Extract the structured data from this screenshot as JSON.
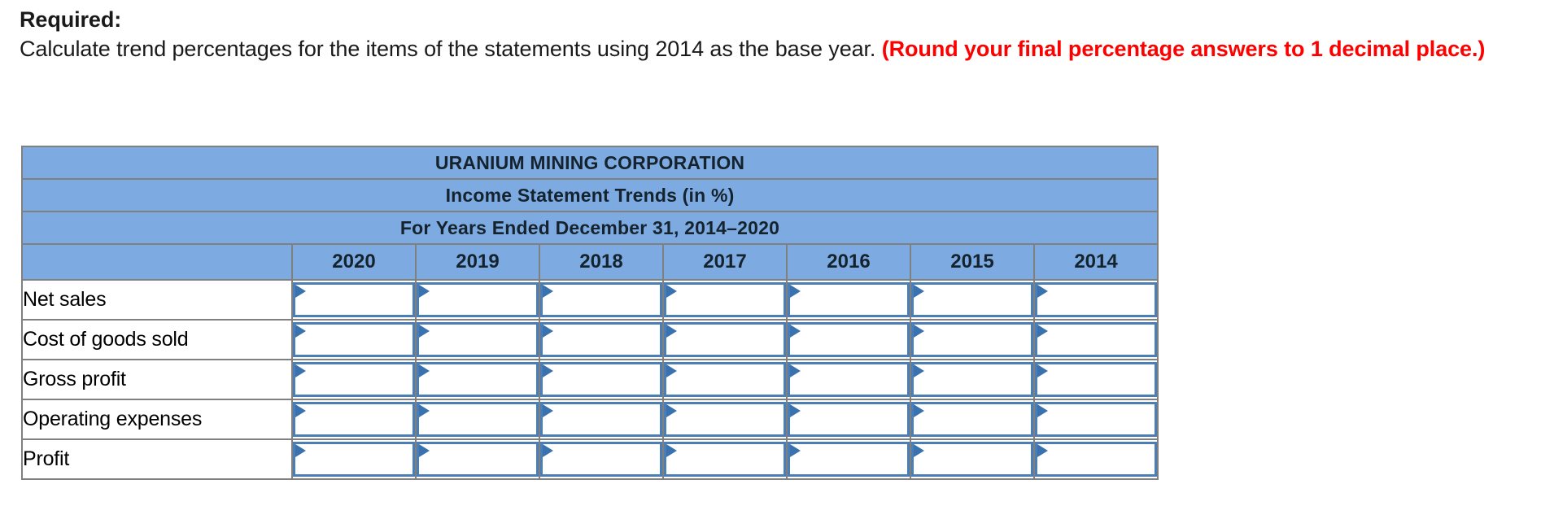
{
  "prompt": {
    "required_label": "Required:",
    "instruction": "Calculate trend percentages for the items of the statements using 2014 as the base year. ",
    "emphasis": "(Round your final percentage answers to 1 decimal place.)"
  },
  "table": {
    "title_line1": "URANIUM MINING CORPORATION",
    "title_line2": "Income Statement Trends (in %)",
    "title_line3": "For Years Ended December 31, 2014–2020",
    "label_header": "",
    "year_columns": [
      "2020",
      "2019",
      "2018",
      "2017",
      "2016",
      "2015",
      "2014"
    ],
    "rows": [
      {
        "label": "Net sales",
        "values": [
          "",
          "",
          "",
          "",
          "",
          "",
          ""
        ],
        "placeholders": [
          "",
          "",
          "",
          "",
          "",
          "",
          ""
        ]
      },
      {
        "label": "Cost of goods sold",
        "values": [
          "",
          "",
          "",
          "",
          "",
          "",
          ""
        ],
        "placeholders": [
          "",
          "",
          "",
          "",
          "",
          "",
          ""
        ]
      },
      {
        "label": "Gross profit",
        "values": [
          "",
          "",
          "",
          "",
          "",
          "",
          ""
        ],
        "placeholders": [
          "",
          "",
          "",
          "",
          "",
          "",
          ""
        ]
      },
      {
        "label": "Operating expenses",
        "values": [
          "",
          "",
          "",
          "",
          "",
          "",
          ""
        ],
        "placeholders": [
          "",
          "",
          "",
          "",
          "",
          "",
          ""
        ]
      },
      {
        "label": "Profit",
        "values": [
          "",
          "",
          "",
          "",
          "",
          "",
          ""
        ],
        "placeholders": [
          "",
          "",
          "",
          "",
          "",
          "",
          ""
        ]
      }
    ]
  },
  "colors": {
    "header_blue": "#7daae0",
    "grid_gray": "#808080",
    "input_border_blue": "#4a7eb5",
    "marker_blue": "#3a72b0",
    "emphasis_red": "#ff0000",
    "text_black": "#1a1a1a"
  }
}
